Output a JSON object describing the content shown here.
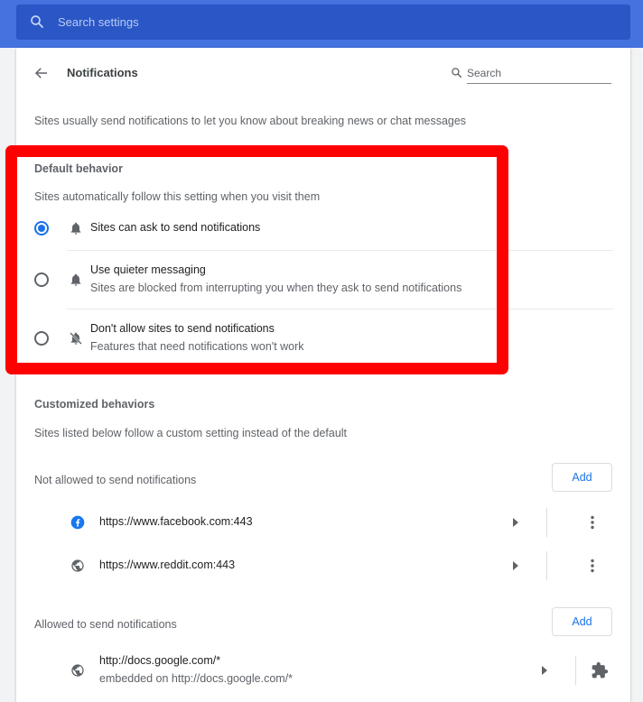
{
  "top_search": {
    "placeholder": "Search settings"
  },
  "header": {
    "title": "Notifications",
    "search_placeholder": "Search"
  },
  "intro": "Sites usually send notifications to let you know about breaking news or chat messages",
  "default_behavior": {
    "heading": "Default behavior",
    "description": "Sites automatically follow this setting when you visit them",
    "options": [
      {
        "label": "Sites can ask to send notifications",
        "sublabel": "",
        "selected": true,
        "icon": "bell-icon"
      },
      {
        "label": "Use quieter messaging",
        "sublabel": "Sites are blocked from interrupting you when they ask to send notifications",
        "selected": false,
        "icon": "bell-icon"
      },
      {
        "label": "Don't allow sites to send notifications",
        "sublabel": "Features that need notifications won't work",
        "selected": false,
        "icon": "bell-off-icon"
      }
    ]
  },
  "customized": {
    "heading": "Customized behaviors",
    "description": "Sites listed below follow a custom setting instead of the default"
  },
  "not_allowed": {
    "label": "Not allowed to send notifications",
    "add_label": "Add",
    "sites": [
      {
        "url": "https://www.facebook.com:443",
        "icon": "facebook-icon"
      },
      {
        "url": "https://www.reddit.com:443",
        "icon": "globe-icon"
      }
    ]
  },
  "allowed": {
    "label": "Allowed to send notifications",
    "add_label": "Add",
    "sites": [
      {
        "url": "http://docs.google.com/*",
        "sublabel": "embedded on http://docs.google.com/*",
        "icon": "globe-icon",
        "action_icon": "puzzle-icon"
      }
    ]
  },
  "colors": {
    "accent": "#1a73e8",
    "topbar": "#4472de",
    "highlight": "#ff0000"
  }
}
